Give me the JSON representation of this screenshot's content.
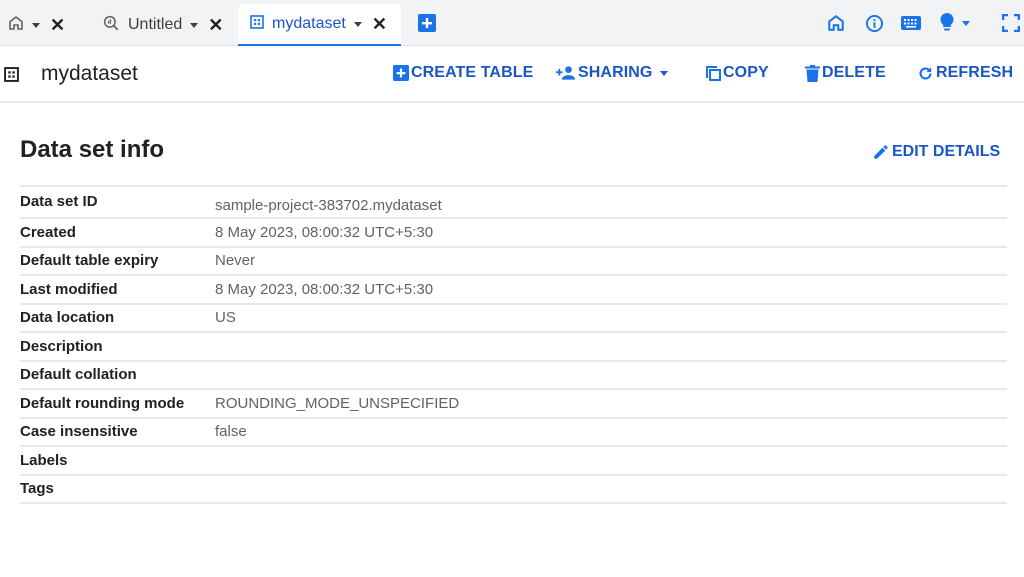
{
  "tabs": [
    {
      "name": "home",
      "label": "",
      "icon": "home-icon",
      "active": false
    },
    {
      "name": "untitled",
      "label": "Untitled",
      "icon": "query-icon",
      "active": false
    },
    {
      "name": "mydataset",
      "label": "mydataset",
      "icon": "dataset-icon",
      "active": true
    }
  ],
  "toolbar_right_icons": [
    "home-icon",
    "info-icon",
    "keyboard-icon",
    "lightbulb-icon",
    "fullscreen-icon"
  ],
  "header": {
    "title": "mydataset",
    "actions": {
      "create_table": "CREATE TABLE",
      "sharing": "SHARING",
      "copy": "COPY",
      "delete": "DELETE",
      "refresh": "REFRESH"
    }
  },
  "section": {
    "title": "Data set info",
    "edit_label": "EDIT DETAILS"
  },
  "info": [
    {
      "key": "Data set ID",
      "value": "sample-project-383702.mydataset"
    },
    {
      "key": "Created",
      "value": "8 May 2023, 08:00:32 UTC+5:30"
    },
    {
      "key": "Default table expiry",
      "value": "Never"
    },
    {
      "key": "Last modified",
      "value": "8 May 2023, 08:00:32 UTC+5:30"
    },
    {
      "key": "Data location",
      "value": "US"
    },
    {
      "key": "Description",
      "value": ""
    },
    {
      "key": "Default collation",
      "value": ""
    },
    {
      "key": "Default rounding mode",
      "value": "ROUNDING_MODE_UNSPECIFIED"
    },
    {
      "key": "Case insensitive",
      "value": "false"
    },
    {
      "key": "Labels",
      "value": ""
    },
    {
      "key": "Tags",
      "value": ""
    }
  ],
  "colors": {
    "accent": "#1a56c6",
    "accent_icon": "#1a73e8",
    "tabbar_bg": "#f1f3f4",
    "divider": "#e8e8e8",
    "value_text": "#5f6368"
  }
}
